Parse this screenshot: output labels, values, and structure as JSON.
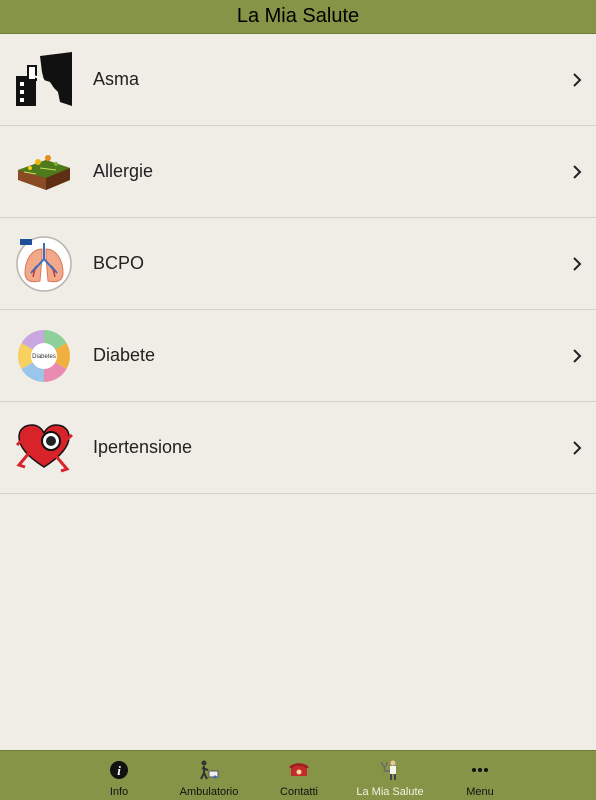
{
  "header": {
    "title": "La Mia Salute"
  },
  "list": {
    "items": [
      {
        "label": "Asma",
        "icon": "asthma-inhaler-icon"
      },
      {
        "label": "Allergie",
        "icon": "allergy-soil-icon"
      },
      {
        "label": "BCPO",
        "icon": "lungs-icon"
      },
      {
        "label": "Diabete",
        "icon": "diabetes-wheel-icon"
      },
      {
        "label": "Ipertensione",
        "icon": "running-heart-icon"
      }
    ]
  },
  "tabbar": {
    "tabs": [
      {
        "label": "Info",
        "icon": "info-icon"
      },
      {
        "label": "Ambulatorio",
        "icon": "ambulatory-icon"
      },
      {
        "label": "Contatti",
        "icon": "telephone-icon"
      },
      {
        "label": "La Mia Salute",
        "icon": "doctor-icon",
        "active": true
      },
      {
        "label": "Menu",
        "icon": "more-dots-icon"
      }
    ]
  },
  "diabetes_badge": "Diabetes",
  "colors": {
    "bar": "#869447",
    "background": "#f0ece6"
  }
}
